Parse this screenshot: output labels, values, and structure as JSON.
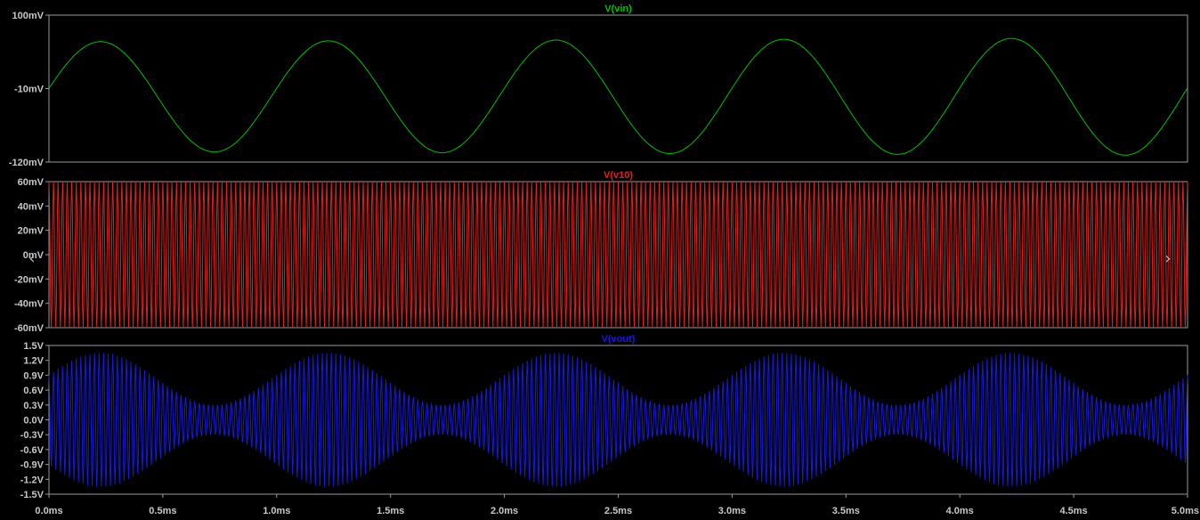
{
  "chart_data": [
    {
      "type": "line",
      "title": "V(vin)",
      "color": "#00c000",
      "signal": {
        "shape": "sine",
        "frequency_hz": 1000,
        "offset_mV": -22,
        "amplitude_mV": 82,
        "phase": "starts near -10mV rising"
      },
      "ylim": [
        -120,
        100
      ],
      "yunit": "mV",
      "yticks": [
        "100mV",
        "-10mV",
        "-120mV"
      ],
      "xlim": [
        0,
        5.0
      ],
      "xunit": "ms"
    },
    {
      "type": "line",
      "title": "V(v10)",
      "color": "#e02020",
      "signal": {
        "shape": "sine",
        "frequency_hz": 50000,
        "offset_mV": 0,
        "amplitude_mV": 60
      },
      "ylim": [
        -60,
        60
      ],
      "yunit": "mV",
      "yticks": [
        "60mV",
        "40mV",
        "20mV",
        "0mV",
        "-20mV",
        "-40mV",
        "-60mV"
      ],
      "xlim": [
        0,
        5.0
      ],
      "xunit": "ms"
    },
    {
      "type": "line",
      "title": "V(vout)",
      "color": "#1818e0",
      "signal": {
        "shape": "amplitude-modulated sine",
        "carrier_frequency_hz": 50000,
        "envelope_frequency_hz": 1000,
        "envelope_min_V": 0.3,
        "envelope_max_V": 1.35
      },
      "ylim": [
        -1.5,
        1.5
      ],
      "yunit": "V",
      "yticks": [
        "1.5V",
        "1.2V",
        "0.9V",
        "0.6V",
        "0.3V",
        "0.0V",
        "-0.3V",
        "-0.6V",
        "-0.9V",
        "-1.2V",
        "-1.5V"
      ],
      "xlim": [
        0,
        5.0
      ],
      "xunit": "ms",
      "xticks": [
        "0.0ms",
        "0.5ms",
        "1.0ms",
        "1.5ms",
        "2.0ms",
        "2.5ms",
        "3.0ms",
        "3.5ms",
        "4.0ms",
        "4.5ms",
        "5.0ms"
      ]
    }
  ],
  "nav": {
    "prev_icon": "‹",
    "next_icon": "›"
  }
}
